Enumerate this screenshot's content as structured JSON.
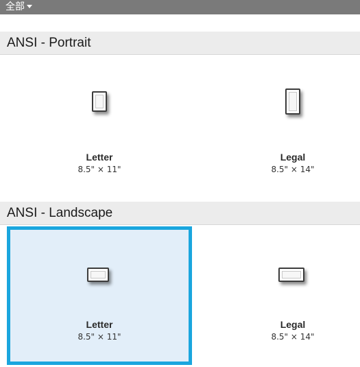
{
  "filter": {
    "label": "全部"
  },
  "sections": [
    {
      "title": "ANSI - Portrait",
      "tiles": [
        {
          "name": "Letter",
          "size": "8.5\" × 11\"",
          "selected": false
        },
        {
          "name": "Legal",
          "size": "8.5\" × 14\"",
          "selected": false
        }
      ]
    },
    {
      "title": "ANSI - Landscape",
      "tiles": [
        {
          "name": "Letter",
          "size": "8.5\" × 11\"",
          "selected": true
        },
        {
          "name": "Legal",
          "size": "8.5\" × 14\"",
          "selected": false
        }
      ]
    }
  ],
  "colors": {
    "selection_border": "#1aa6de",
    "selection_fill": "#e2eef9",
    "section_header_bg": "#ececec",
    "filter_bar_bg": "#7a7a7a"
  },
  "icons": {
    "filter_dropdown": "chevron-down-icon",
    "paper_portrait": "paper-portrait-icon",
    "paper_landscape": "paper-landscape-icon"
  }
}
